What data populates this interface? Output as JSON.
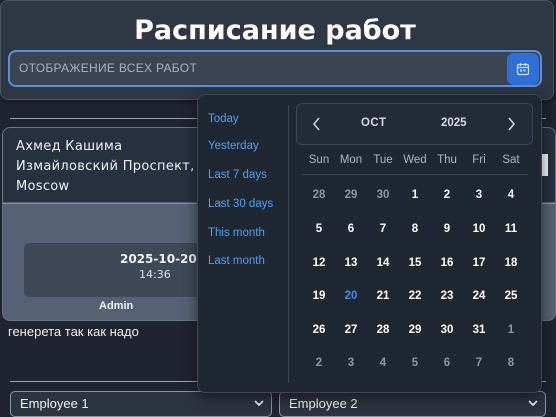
{
  "header": {
    "title": "Расписание работ",
    "search_value": "ОТОБРАЖЕНИЕ ВСЕХ РАБОТ"
  },
  "card": {
    "address_line1": "Ахмед Кашима",
    "address_line2": "Измайловский Проспект,",
    "address_line3": "Moscow",
    "date": "2025-10-20",
    "time": "14:36",
    "author": "Admin",
    "note": "генерета так как надо"
  },
  "selects": [
    {
      "label": "Employee 1"
    },
    {
      "label": "Employee 2"
    }
  ],
  "picker": {
    "presets": [
      "Today",
      "Yesterday",
      "Last 7 days",
      "Last 30 days",
      "This month",
      "Last month"
    ],
    "month": "OCT",
    "year": "2025",
    "weekdays": [
      "Sun",
      "Mon",
      "Tue",
      "Wed",
      "Thu",
      "Fri",
      "Sat"
    ],
    "weeks": [
      [
        "28",
        "29",
        "30",
        "1",
        "2",
        "3",
        "4"
      ],
      [
        "5",
        "6",
        "7",
        "8",
        "9",
        "10",
        "11"
      ],
      [
        "12",
        "13",
        "14",
        "15",
        "16",
        "17",
        "18"
      ],
      [
        "19",
        "20",
        "21",
        "22",
        "23",
        "24",
        "25"
      ],
      [
        "26",
        "27",
        "28",
        "29",
        "30",
        "31",
        "1"
      ],
      [
        "2",
        "3",
        "4",
        "5",
        "6",
        "7",
        "8"
      ]
    ],
    "muted_flags": [
      [
        true,
        true,
        true,
        false,
        false,
        false,
        false
      ],
      [
        false,
        false,
        false,
        false,
        false,
        false,
        false
      ],
      [
        false,
        false,
        false,
        false,
        false,
        false,
        false
      ],
      [
        false,
        false,
        false,
        false,
        false,
        false,
        false
      ],
      [
        false,
        false,
        false,
        false,
        false,
        false,
        true
      ],
      [
        true,
        true,
        true,
        true,
        true,
        true,
        true
      ]
    ],
    "today": "20"
  },
  "colors": {
    "accent": "#2f6fd6",
    "link": "#4ea0f0",
    "today": "#3f8fe8"
  }
}
